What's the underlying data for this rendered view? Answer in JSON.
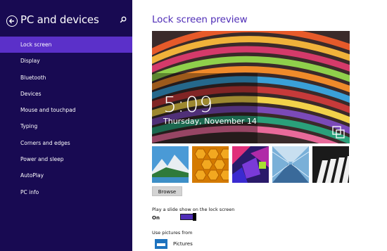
{
  "sidebar": {
    "title": "PC and devices",
    "items": [
      {
        "label": "Lock screen",
        "active": true
      },
      {
        "label": "Display"
      },
      {
        "label": "Bluetooth"
      },
      {
        "label": "Devices"
      },
      {
        "label": "Mouse and touchpad"
      },
      {
        "label": "Typing"
      },
      {
        "label": "Corners and edges"
      },
      {
        "label": "Power and sleep"
      },
      {
        "label": "AutoPlay"
      },
      {
        "label": "PC info"
      }
    ]
  },
  "main": {
    "title": "Lock screen preview",
    "preview": {
      "time": "5:09",
      "date": "Thursday, November 14"
    },
    "browse_label": "Browse",
    "slideshow": {
      "label": "Play a slide show on the lock screen",
      "state": "On"
    },
    "use_pictures_from": {
      "label": "Use pictures from",
      "source": "Pictures"
    }
  },
  "colors": {
    "sidebar_bg": "#180a52",
    "nav_active": "#5b30c9",
    "accent": "#4f2db7"
  }
}
